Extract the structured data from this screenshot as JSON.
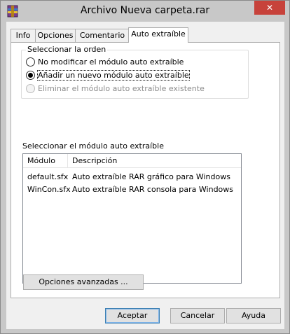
{
  "window": {
    "title": "Archivo Nueva carpeta.rar",
    "close_label": "✕",
    "icon": "winrar-archive-icon"
  },
  "tabs": [
    {
      "label": "Info",
      "active": false
    },
    {
      "label": "Opciones",
      "active": false
    },
    {
      "label": "Comentario",
      "active": false
    },
    {
      "label": "Auto extraíble",
      "active": true
    }
  ],
  "order_group": {
    "legend": "Seleccionar la orden",
    "options": [
      {
        "label": "No modificar el módulo auto extraíble",
        "checked": false,
        "enabled": true
      },
      {
        "label": "Añadir un nuevo módulo auto extraíble",
        "checked": true,
        "enabled": true
      },
      {
        "label": "Eliminar el módulo auto extraíble existente",
        "checked": false,
        "enabled": false
      }
    ]
  },
  "module_list": {
    "label": "Seleccionar el módulo auto extraíble",
    "columns": [
      "Módulo",
      "Descripción"
    ],
    "rows": [
      [
        "default.sfx",
        "Auto extraíble RAR gráfico para Windows"
      ],
      [
        "WinCon.sfx",
        "Auto extraíble RAR consola para Windows"
      ]
    ]
  },
  "advanced_button": "Opciones avanzadas ...",
  "footer": {
    "ok": "Aceptar",
    "cancel": "Cancelar",
    "help": "Ayuda"
  },
  "colors": {
    "close_button": "#c7423b",
    "frame": "#c8c8c8",
    "dialog_bg": "#f0f0f0",
    "default_button_border": "#3c7fb1"
  }
}
